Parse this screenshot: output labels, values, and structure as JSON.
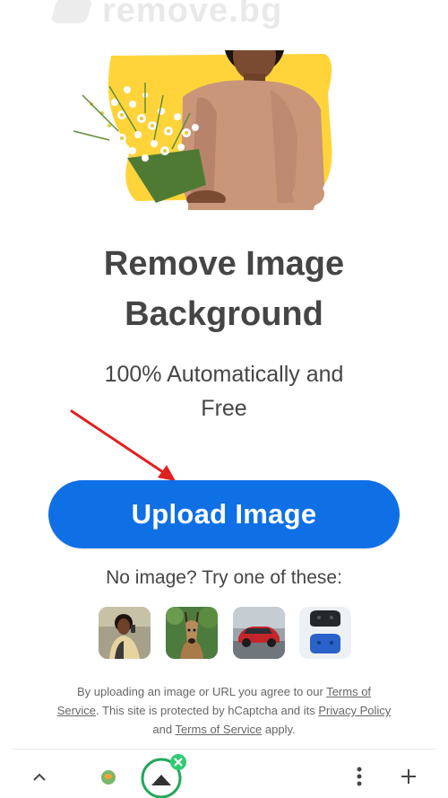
{
  "header": {
    "logo_text": "remove.bg"
  },
  "hero": {
    "title": "Remove Image Background"
  },
  "subtitle": {
    "line1": "100% Automatically and",
    "highlight": "Free"
  },
  "upload": {
    "label": "Upload Image"
  },
  "samples": {
    "prompt": "No image? Try one of these:",
    "items": [
      "person-sample",
      "animal-sample",
      "car-sample",
      "product-sample"
    ]
  },
  "legal": {
    "part1": "By uploading an image or URL you agree to our ",
    "terms1": "Terms of Service",
    "part2": ". This site is protected by hCaptcha and its ",
    "privacy": "Privacy Policy",
    "part3": " and ",
    "terms2": "Terms of Service",
    "part4": " apply."
  },
  "colors": {
    "primary": "#0f70e6",
    "highlight": "#ffd43b",
    "text": "#454545",
    "arrow": "#e02020",
    "badge": "#2ecc71"
  },
  "bottom_bar": {
    "icons": [
      "chevron-up-icon",
      "browser-shield-icon",
      "tab-switcher-icon",
      "more-vertical-icon",
      "plus-icon"
    ]
  }
}
